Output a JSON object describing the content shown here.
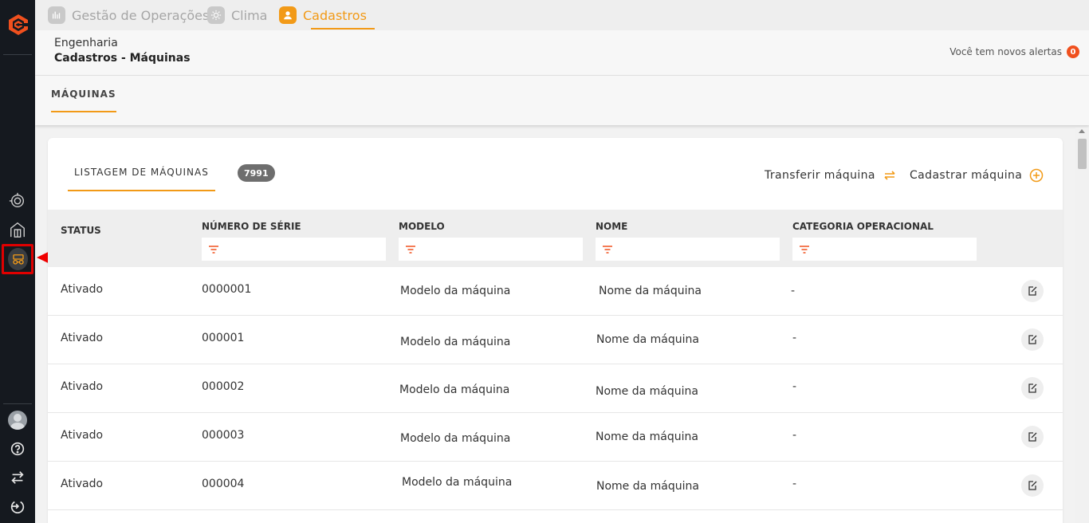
{
  "top_tabs": [
    {
      "label": "Gestão de Operações",
      "icon": "operations-icon"
    },
    {
      "label": "Clima",
      "icon": "sun-icon"
    },
    {
      "label": "Cadastros",
      "icon": "user-icon",
      "active": true
    }
  ],
  "header": {
    "crumb_parent": "Engenharia",
    "crumb_current": "Cadastros - Máquinas",
    "alerts_text": "Você tem novos alertas",
    "alerts_count": "0"
  },
  "subnav": {
    "tab": "MÁQUINAS"
  },
  "card": {
    "list_tab": "LISTAGEM DE MÁQUINAS",
    "count": "7991",
    "transfer_label": "Transferir máquina",
    "register_label": "Cadastrar máquina"
  },
  "table": {
    "columns": {
      "status": "STATUS",
      "serial": "NÚMERO DE SÉRIE",
      "model": "MODELO",
      "name": "NOME",
      "category": "CATEGORIA OPERACIONAL"
    },
    "rows": [
      {
        "status": "Ativado",
        "serial": "0000001",
        "model": "Modelo da máquina",
        "name": "Nome da máquina",
        "category": "-"
      },
      {
        "status": "Ativado",
        "serial": "000001",
        "model": "Modelo da máquina",
        "name": "Nome da máquina",
        "category": "-"
      },
      {
        "status": "Ativado",
        "serial": "000002",
        "model": "Modelo da máquina",
        "name": "Nome da máquina",
        "category": "-"
      },
      {
        "status": "Ativado",
        "serial": "000003",
        "model": "Modelo da máquina",
        "name": "Nome da máquina",
        "category": "-"
      },
      {
        "status": "Ativado",
        "serial": "000004",
        "model": "Modelo da máquina",
        "name": "Nome da máquina",
        "category": "-"
      }
    ]
  },
  "colors": {
    "accent": "#f29a17",
    "sidebar": "#15191f",
    "highlight": "#e00000",
    "badge_alert": "#f0501e"
  }
}
